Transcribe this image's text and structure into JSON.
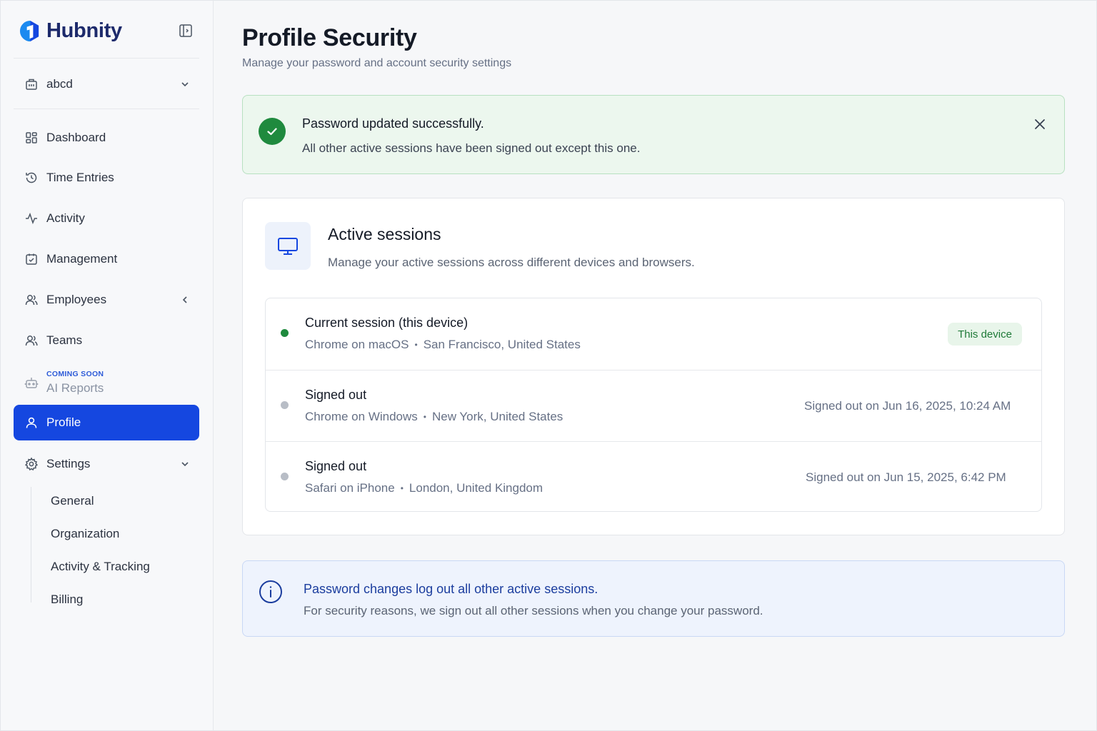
{
  "app": {
    "name": "Hubnity",
    "brand_color": "#1547e0"
  },
  "workspace": {
    "name": "abcd",
    "icon": "building-icon"
  },
  "sidebar": {
    "items": [
      {
        "label": "Dashboard",
        "icon": "grid-icon"
      },
      {
        "label": "Time Entries",
        "icon": "history-icon"
      },
      {
        "label": "Activity",
        "icon": "activity-icon"
      },
      {
        "label": "Management",
        "icon": "calendar-check-icon"
      },
      {
        "label": "Employees",
        "icon": "users-icon"
      },
      {
        "label": "Teams",
        "icon": "users-icon"
      },
      {
        "label": "AI Reports",
        "icon": "bot-icon",
        "badge": "COMING SOON"
      },
      {
        "label": "Profile",
        "icon": "user-icon",
        "active": true
      },
      {
        "label": "Settings",
        "icon": "gear-icon"
      }
    ],
    "settings_sub": [
      "General",
      "Organization",
      "Activity & Tracking",
      "Billing"
    ]
  },
  "header": {
    "title": "Profile Security",
    "subtitle": "Manage your password and account security settings"
  },
  "success_alert": {
    "title": "Password updated successfully.",
    "message": "All other active sessions have been signed out except this one.",
    "color": "#1f8a3e"
  },
  "sessions_card": {
    "title": "Active sessions",
    "subtitle": "Manage your active sessions across different devices and browsers.",
    "sessions": [
      {
        "title": "Current session (this device)",
        "client": "Chrome on macOS",
        "location": "San Francisco, United States",
        "status": "active",
        "badge": "This device"
      },
      {
        "title": "Signed out",
        "client": "Chrome on Windows",
        "location": "New York, United States",
        "status": "signed-out",
        "right_text": "Signed out on Jun 16, 2025, 10:24 AM"
      },
      {
        "title": "Signed out",
        "client": "Safari on iPhone",
        "location": "London, United Kingdom",
        "status": "signed-out",
        "right_text": "Signed out on Jun 15, 2025, 6:42 PM"
      }
    ]
  },
  "info_alert": {
    "title": "Password changes log out all other active sessions.",
    "message": "For security reasons, we sign out all other sessions when you change your password."
  }
}
